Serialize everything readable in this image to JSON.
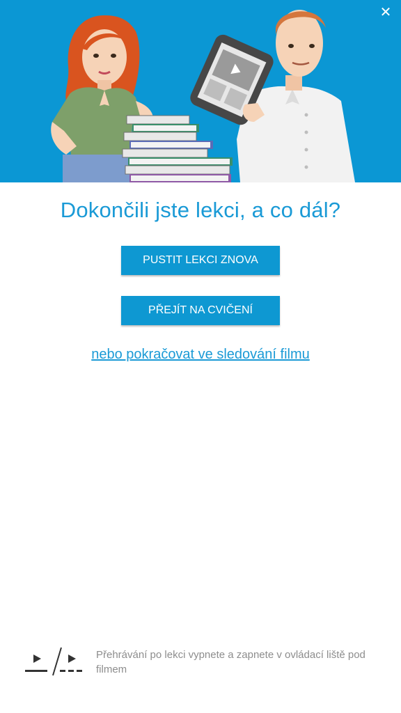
{
  "header": {
    "close_icon": "close-icon",
    "close_glyph": "✕"
  },
  "illustration": {
    "description_icon": "people-with-books-and-tablet-illustration",
    "background_color": "#0b97d4"
  },
  "main": {
    "headline": "Dokončili jste lekci, a co dál?",
    "replay_label": "PUSTIT LEKCI ZNOVA",
    "exercise_label": "PŘEJÍT NA CVIČENÍ",
    "continue_link": "nebo pokračovat ve sledování filmu"
  },
  "footer": {
    "icon": "autoplay-toggle-icon",
    "hint": "Přehrávání po lekci vypnete a zapnete v ovládací liště pod filmem"
  },
  "colors": {
    "accent": "#1a9ad6",
    "button": "#0e98d2",
    "muted_text": "#8d8d8d"
  }
}
